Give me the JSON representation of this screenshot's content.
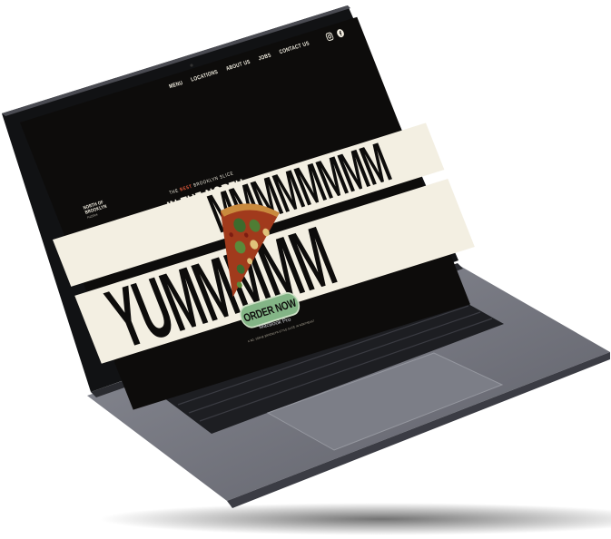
{
  "nav": {
    "items": [
      "MENU",
      "LOCATIONS",
      "ABOUT US",
      "JOBS",
      "CONTACT US"
    ],
    "social_icons": [
      "instagram-icon",
      "facebook-icon"
    ]
  },
  "logo": {
    "line1": "NORTH OF",
    "line2": "BROOKLYN",
    "line3": "PIZZERIA"
  },
  "hero": {
    "tag_pre": "THE",
    "tag_accent": "BEST",
    "tag_post": "BROOKLYN SLICE",
    "tag_big": "IN THE NORTH",
    "band_top": "MMMMMMMM",
    "band_bottom": "YUMMMMM",
    "order_button": "ORDER NOW",
    "footer_line": "A NO. SERVE BROOKLYN-STYLE SLICE IN NORTHEAST"
  },
  "device": {
    "label": "MacBook Pro"
  },
  "colors": {
    "cream": "#f3efe2",
    "black": "#0d0c0b",
    "green": "#83b586",
    "accent": "#e55b3c",
    "laptop": "#6f7079"
  }
}
